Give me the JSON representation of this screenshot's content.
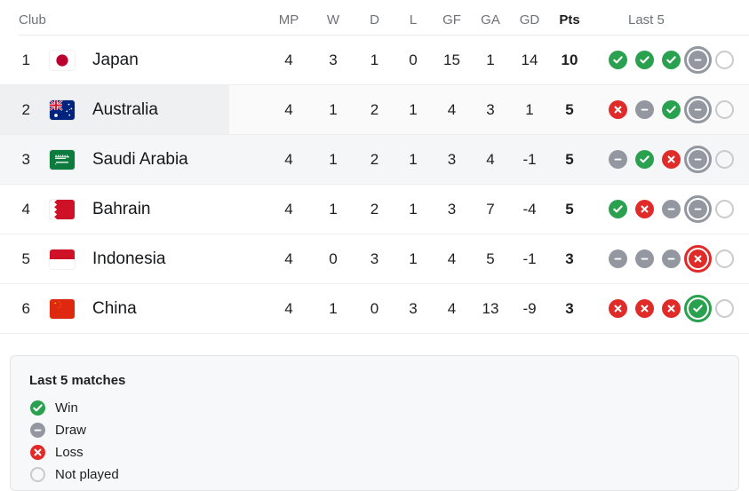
{
  "table": {
    "columns": {
      "club": "Club",
      "mp": "MP",
      "w": "W",
      "d": "D",
      "l": "L",
      "gf": "GF",
      "ga": "GA",
      "gd": "GD",
      "pts": "Pts",
      "last5": "Last 5"
    },
    "rows": [
      {
        "rank": "1",
        "team": "Japan",
        "flag": "japan-flag",
        "mp": "4",
        "w": "3",
        "d": "1",
        "l": "0",
        "gf": "15",
        "ga": "1",
        "gd": "14",
        "pts": "10",
        "form": [
          "win",
          "win",
          "win",
          "draw",
          "none"
        ],
        "form_ring_index": 3,
        "highlight": "none"
      },
      {
        "rank": "2",
        "team": "Australia",
        "flag": "australia-flag",
        "mp": "4",
        "w": "1",
        "d": "2",
        "l": "1",
        "gf": "4",
        "ga": "3",
        "gd": "1",
        "pts": "5",
        "form": [
          "loss",
          "draw",
          "win",
          "draw",
          "none"
        ],
        "form_ring_index": 3,
        "highlight": "hovered"
      },
      {
        "rank": "3",
        "team": "Saudi Arabia",
        "flag": "saudi-arabia-flag",
        "mp": "4",
        "w": "1",
        "d": "2",
        "l": "1",
        "gf": "3",
        "ga": "4",
        "gd": "-1",
        "pts": "5",
        "form": [
          "draw",
          "win",
          "loss",
          "draw",
          "none"
        ],
        "form_ring_index": 3,
        "highlight": "shaded"
      },
      {
        "rank": "4",
        "team": "Bahrain",
        "flag": "bahrain-flag",
        "mp": "4",
        "w": "1",
        "d": "2",
        "l": "1",
        "gf": "3",
        "ga": "7",
        "gd": "-4",
        "pts": "5",
        "form": [
          "win",
          "loss",
          "draw",
          "draw",
          "none"
        ],
        "form_ring_index": 3,
        "highlight": "none"
      },
      {
        "rank": "5",
        "team": "Indonesia",
        "flag": "indonesia-flag",
        "mp": "4",
        "w": "0",
        "d": "3",
        "l": "1",
        "gf": "4",
        "ga": "5",
        "gd": "-1",
        "pts": "3",
        "form": [
          "draw",
          "draw",
          "draw",
          "loss",
          "none"
        ],
        "form_ring_index": 3,
        "highlight": "none"
      },
      {
        "rank": "6",
        "team": "China",
        "flag": "china-flag",
        "mp": "4",
        "w": "1",
        "d": "0",
        "l": "3",
        "gf": "4",
        "ga": "13",
        "gd": "-9",
        "pts": "3",
        "form": [
          "loss",
          "loss",
          "loss",
          "win",
          "none"
        ],
        "form_ring_index": 3,
        "highlight": "none"
      }
    ]
  },
  "legend": {
    "title": "Last 5 matches",
    "items": [
      {
        "key": "win",
        "label": "Win"
      },
      {
        "key": "draw",
        "label": "Draw"
      },
      {
        "key": "loss",
        "label": "Loss"
      },
      {
        "key": "none",
        "label": "Not played"
      }
    ]
  },
  "colors": {
    "win": "#2aa14f",
    "draw": "#9297a0",
    "loss": "#e02b28",
    "not_played_border": "#c8cacd",
    "row_shaded": "#f5f6f7",
    "row_hovered": "#eff0f2",
    "text": "#1f1f1f",
    "header_text": "#6e7277"
  }
}
